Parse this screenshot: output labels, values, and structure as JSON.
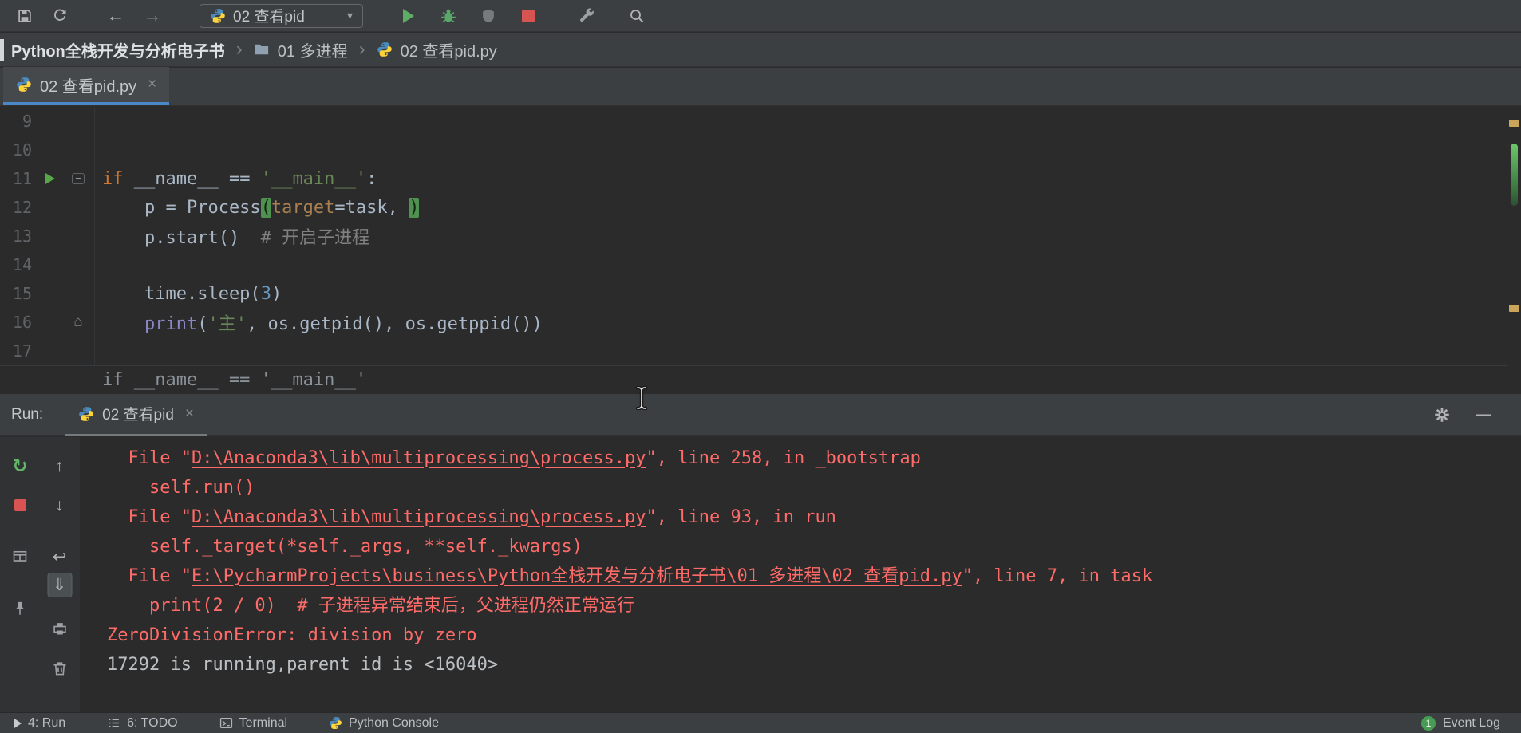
{
  "colors": {
    "toolbar_bg": "#3c3f41",
    "editor_bg": "#2b2b2b",
    "accent_blue": "#4a88c7",
    "error_red": "#ff6b68",
    "stdout_text": "#bcc0c4",
    "keyword": "#cc7832",
    "string": "#6a8759",
    "number": "#6897bb",
    "comment": "#808080",
    "builtin": "#8888c6",
    "param": "#aa8050",
    "default_text": "#a9b7c6",
    "line_number": "#606366",
    "run_green": "#59a869",
    "stop_red": "#d75452",
    "event_badge_green": "#499c54"
  },
  "toolbar": {
    "run_config_label": "02 查看pid"
  },
  "breadcrumb": {
    "project": "Python全栈开发与分析电子书",
    "folder": "01 多进程",
    "file": "02 查看pid.py",
    "sep": "›"
  },
  "editor_tab": {
    "label": "02 查看pid.py",
    "close": "×"
  },
  "editor": {
    "context_line": "if __name__ == '__main__'",
    "lines": [
      {
        "num": "9",
        "segs": []
      },
      {
        "num": "10",
        "segs": []
      },
      {
        "num": "11",
        "run": true,
        "fold": "start",
        "segs": [
          [
            "kw",
            "if "
          ],
          [
            "def",
            "__name__ == "
          ],
          [
            "str",
            "'__main__'"
          ],
          [
            "def",
            ":"
          ]
        ]
      },
      {
        "num": "12",
        "segs": [
          [
            "def",
            "    p = Process"
          ],
          [
            "brace",
            "("
          ],
          [
            "param",
            "target"
          ],
          [
            "def",
            "=task, "
          ],
          [
            "brace",
            ")"
          ]
        ]
      },
      {
        "num": "13",
        "segs": [
          [
            "def",
            "    p.start()  "
          ],
          [
            "com",
            "# 开启子进程"
          ]
        ]
      },
      {
        "num": "14",
        "segs": []
      },
      {
        "num": "15",
        "segs": [
          [
            "def",
            "    time.sleep("
          ],
          [
            "num",
            "3"
          ],
          [
            "def",
            ")"
          ]
        ]
      },
      {
        "num": "16",
        "fold": "end",
        "segs": [
          [
            "def",
            "    "
          ],
          [
            "builtin",
            "print"
          ],
          [
            "def",
            "("
          ],
          [
            "str",
            "'主'"
          ],
          [
            "def",
            ", os.getpid(), os.getppid())"
          ]
        ]
      },
      {
        "num": "17",
        "segs": []
      }
    ]
  },
  "run_panel": {
    "label": "Run:",
    "tab_label": "02 查看pid",
    "close": "×"
  },
  "console": {
    "lines": [
      {
        "cls": "err",
        "parts": [
          {
            "t": "  File \""
          },
          {
            "t": "D:\\Anaconda3\\lib\\multiprocessing\\process.py",
            "link": true
          },
          {
            "t": "\", line 258, in _bootstrap"
          }
        ]
      },
      {
        "cls": "err",
        "parts": [
          {
            "t": "    self.run()"
          }
        ]
      },
      {
        "cls": "err",
        "parts": [
          {
            "t": "  File \""
          },
          {
            "t": "D:\\Anaconda3\\lib\\multiprocessing\\process.py",
            "link": true
          },
          {
            "t": "\", line 93, in run"
          }
        ]
      },
      {
        "cls": "err",
        "parts": [
          {
            "t": "    self._target(*self._args, **self._kwargs)"
          }
        ]
      },
      {
        "cls": "err",
        "parts": [
          {
            "t": "  File \""
          },
          {
            "t": "E:\\PycharmProjects\\business\\Python全栈开发与分析电子书\\01 多进程\\02 查看pid.py",
            "link": true
          },
          {
            "t": "\", line 7, in task"
          }
        ]
      },
      {
        "cls": "err",
        "parts": [
          {
            "t": "    print(2 / 0)  # 子进程异常结束后，父进程仍然正常运行"
          }
        ]
      },
      {
        "cls": "err",
        "parts": [
          {
            "t": "ZeroDivisionError: division by zero"
          }
        ]
      },
      {
        "cls": "out",
        "parts": [
          {
            "t": "17292 is running,parent id is <16040>"
          }
        ]
      }
    ]
  },
  "status_bar": {
    "run": "4: Run",
    "todo": "6: TODO",
    "terminal": "Terminal",
    "python_console": "Python Console",
    "event_log": "Event Log",
    "event_badge": "1"
  },
  "glyphs": {
    "back": "←",
    "forward": "→",
    "chevron_down": "▾",
    "close": "×",
    "up": "↑",
    "down": "↓",
    "soft_wrap": "↩",
    "scroll_end": "⇓",
    "rerun": "↻",
    "fold_end": "⌂",
    "fold_start": "−",
    "minimize": "—"
  }
}
